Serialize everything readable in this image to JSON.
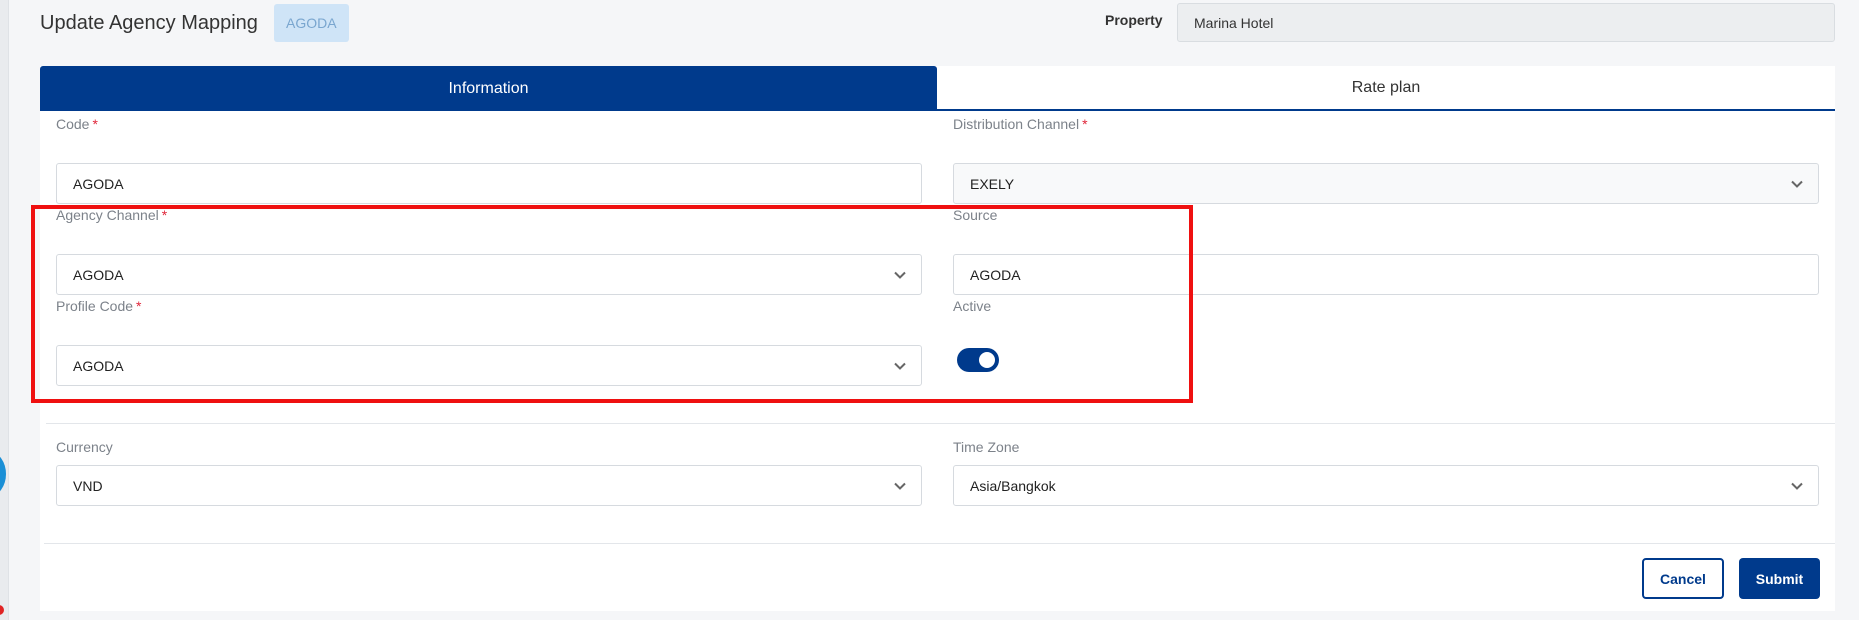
{
  "header": {
    "title": "Update Agency Mapping",
    "badge": "AGODA",
    "property_label": "Property",
    "property_value": "Marina Hotel"
  },
  "tabs": [
    {
      "label": "Information",
      "active": true
    },
    {
      "label": "Rate plan",
      "active": false
    }
  ],
  "form": {
    "code": {
      "label": "Code",
      "required": "*",
      "value": "AGODA"
    },
    "distribution_channel": {
      "label": "Distribution Channel",
      "required": "*",
      "value": "EXELY"
    },
    "agency_channel": {
      "label": "Agency Channel",
      "required": "*",
      "value": "AGODA"
    },
    "source": {
      "label": "Source",
      "value": "AGODA"
    },
    "profile_code": {
      "label": "Profile Code",
      "required": "*",
      "value": "AGODA"
    },
    "active": {
      "label": "Active",
      "on": true
    },
    "currency": {
      "label": "Currency",
      "value": "VND"
    },
    "time_zone": {
      "label": "Time Zone",
      "value": "Asia/Bangkok"
    }
  },
  "buttons": {
    "cancel": "Cancel",
    "submit": "Submit"
  },
  "colors": {
    "primary": "#003a8c",
    "highlight": "#ef1010",
    "required": "#e0263a"
  }
}
